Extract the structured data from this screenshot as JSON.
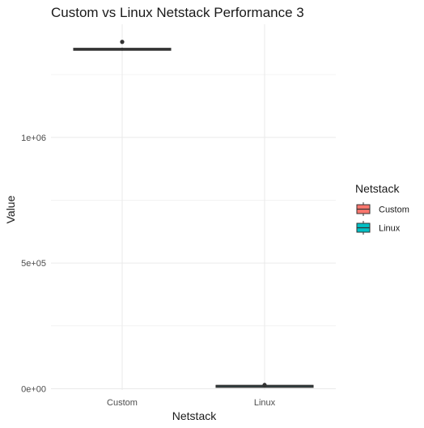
{
  "chart_data": {
    "type": "box",
    "title": "Custom vs Linux Netstack Performance 3",
    "xlabel": "Netstack",
    "ylabel": "Value",
    "categories": [
      "Custom",
      "Linux"
    ],
    "ylim": [
      -5000,
      1450000
    ],
    "y_ticks": [
      {
        "value": 0,
        "label": "0e+00"
      },
      {
        "value": 500000,
        "label": "5e+05"
      },
      {
        "value": 1000000,
        "label": "1e+06"
      }
    ],
    "grid": true,
    "legend": {
      "title": "Netstack",
      "position": "right",
      "entries": [
        {
          "label": "Custom",
          "color": "#F8766D"
        },
        {
          "label": "Linux",
          "color": "#00BFC4"
        }
      ]
    },
    "series": [
      {
        "category": "Custom",
        "color": "#F8766D",
        "whisker_low": 1345000,
        "q1": 1347000,
        "median": 1350000,
        "q3": 1354000,
        "whisker_high": 1357000,
        "outliers": [
          1380000
        ]
      },
      {
        "category": "Linux",
        "color": "#00BFC4",
        "whisker_low": 9000,
        "q1": 10000,
        "median": 11500,
        "q3": 13000,
        "whisker_high": 14000,
        "outliers": [
          15000
        ]
      }
    ]
  }
}
